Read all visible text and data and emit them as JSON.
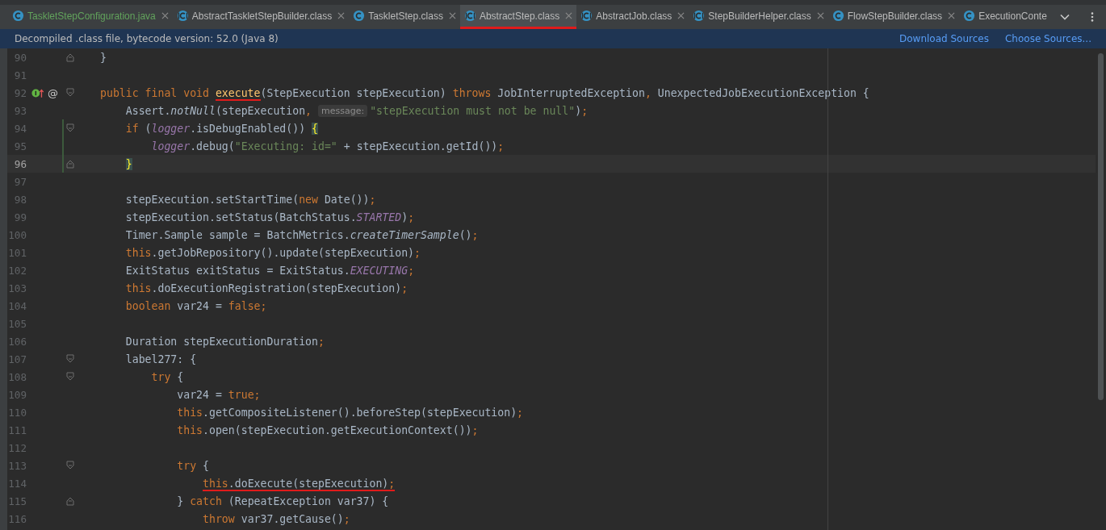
{
  "tabs": [
    {
      "label": "TaskletStepConfiguration.java",
      "kind": "class",
      "color": "#62a35c",
      "selected": false
    },
    {
      "label": "AbstractTaskletStepBuilder.class",
      "kind": "abstract-class",
      "color": "#bbbbbb",
      "selected": false
    },
    {
      "label": "TaskletStep.class",
      "kind": "class",
      "color": "#bbbbbb",
      "selected": false
    },
    {
      "label": "AbstractStep.class",
      "kind": "abstract-class",
      "color": "#bbbbbb",
      "selected": true
    },
    {
      "label": "AbstractJob.class",
      "kind": "abstract-class",
      "color": "#bbbbbb",
      "selected": false
    },
    {
      "label": "StepBuilderHelper.class",
      "kind": "abstract-class",
      "color": "#bbbbbb",
      "selected": false
    },
    {
      "label": "FlowStepBuilder.class",
      "kind": "class",
      "color": "#bbbbbb",
      "selected": false
    },
    {
      "label": "ExecutionConte",
      "kind": "class",
      "color": "#bbbbbb",
      "selected": false
    }
  ],
  "banner": {
    "message": "Decompiled .class file, bytecode version: 52.0 (Java 8)",
    "links": [
      "Download Sources",
      "Choose Sources..."
    ]
  },
  "lines": [
    {
      "number": "90",
      "fold_end": true,
      "tokens": [
        {
          "kind": "plain",
          "text": "}"
        }
      ]
    },
    {
      "number": "91"
    },
    {
      "number": "92",
      "fold_start": true,
      "gutter": "@",
      "implements": true,
      "tokens": [
        {
          "kind": "keyword",
          "text": "public final void "
        },
        {
          "kind": "declaration",
          "text": "execute",
          "underlined": true
        },
        {
          "kind": "plain",
          "text": "(StepExecution stepExecution) "
        },
        {
          "kind": "keyword",
          "text": "throws "
        },
        {
          "kind": "plain",
          "text": "JobInterruptedException"
        },
        {
          "kind": "keyword",
          "text": ", "
        },
        {
          "kind": "plain",
          "text": "UnexpectedJobExecutionException {"
        }
      ]
    },
    {
      "number": "93",
      "tokens": [
        {
          "kind": "plain",
          "text": "    Assert."
        },
        {
          "kind": "static",
          "text": "notNull"
        },
        {
          "kind": "plain",
          "text": "(stepExecution"
        },
        {
          "kind": "keyword",
          "text": ", "
        },
        {
          "kind": "hint",
          "text": "message:"
        },
        {
          "kind": "string",
          "text": "\"stepExecution must not be null\""
        },
        {
          "kind": "plain",
          "text": ")"
        },
        {
          "kind": "keyword",
          "text": ";"
        }
      ]
    },
    {
      "number": "94",
      "fold_start": true,
      "changed": true,
      "tokens": [
        {
          "kind": "keyword",
          "text": "    if "
        },
        {
          "kind": "plain",
          "text": "("
        },
        {
          "kind": "field",
          "text": "logger"
        },
        {
          "kind": "plain",
          "text": ".isDebugEnabled()) "
        },
        {
          "kind": "brace",
          "text": "{"
        }
      ]
    },
    {
      "number": "95",
      "changed": true,
      "tokens": [
        {
          "kind": "field",
          "text": "        logger"
        },
        {
          "kind": "plain",
          "text": ".debug("
        },
        {
          "kind": "string",
          "text": "\"Executing: id=\""
        },
        {
          "kind": "plain",
          "text": " + stepExecution.getId())"
        },
        {
          "kind": "keyword",
          "text": ";"
        }
      ]
    },
    {
      "number": "96",
      "fold_end": true,
      "changed": true,
      "current": true,
      "tokens": [
        {
          "kind": "brace",
          "text": "    }"
        }
      ]
    },
    {
      "number": "97"
    },
    {
      "number": "98",
      "tokens": [
        {
          "kind": "plain",
          "text": "    stepExecution.setStartTime("
        },
        {
          "kind": "keyword",
          "text": "new "
        },
        {
          "kind": "plain",
          "text": "Date())"
        },
        {
          "kind": "keyword",
          "text": ";"
        }
      ]
    },
    {
      "number": "99",
      "tokens": [
        {
          "kind": "plain",
          "text": "    stepExecution.setStatus(BatchStatus."
        },
        {
          "kind": "constant",
          "text": "STARTED"
        },
        {
          "kind": "plain",
          "text": ")"
        },
        {
          "kind": "keyword",
          "text": ";"
        }
      ]
    },
    {
      "number": "100",
      "tokens": [
        {
          "kind": "plain",
          "text": "    Timer.Sample sample = BatchMetrics."
        },
        {
          "kind": "static",
          "text": "createTimerSample"
        },
        {
          "kind": "plain",
          "text": "()"
        },
        {
          "kind": "keyword",
          "text": ";"
        }
      ]
    },
    {
      "number": "101",
      "tokens": [
        {
          "kind": "keyword",
          "text": "    this"
        },
        {
          "kind": "plain",
          "text": ".getJobRepository().update(stepExecution)"
        },
        {
          "kind": "keyword",
          "text": ";"
        }
      ]
    },
    {
      "number": "102",
      "tokens": [
        {
          "kind": "plain",
          "text": "    ExitStatus exitStatus = ExitStatus."
        },
        {
          "kind": "constant",
          "text": "EXECUTING"
        },
        {
          "kind": "keyword",
          "text": ";"
        }
      ]
    },
    {
      "number": "103",
      "tokens": [
        {
          "kind": "keyword",
          "text": "    this"
        },
        {
          "kind": "plain",
          "text": ".doExecutionRegistration(stepExecution)"
        },
        {
          "kind": "keyword",
          "text": ";"
        }
      ]
    },
    {
      "number": "104",
      "tokens": [
        {
          "kind": "keyword",
          "text": "    boolean "
        },
        {
          "kind": "plain",
          "text": "var24 = "
        },
        {
          "kind": "keyword",
          "text": "false;"
        }
      ]
    },
    {
      "number": "105"
    },
    {
      "number": "106",
      "tokens": [
        {
          "kind": "plain",
          "text": "    Duration stepExecutionDuration"
        },
        {
          "kind": "keyword",
          "text": ";"
        }
      ]
    },
    {
      "number": "107",
      "fold_start": true,
      "tokens": [
        {
          "kind": "plain",
          "text": "    label277: {"
        }
      ]
    },
    {
      "number": "108",
      "fold_start": true,
      "tokens": [
        {
          "kind": "keyword",
          "text": "        try "
        },
        {
          "kind": "plain",
          "text": "{"
        }
      ]
    },
    {
      "number": "109",
      "tokens": [
        {
          "kind": "plain",
          "text": "            var24 = "
        },
        {
          "kind": "keyword",
          "text": "true;"
        }
      ]
    },
    {
      "number": "110",
      "tokens": [
        {
          "kind": "keyword",
          "text": "            this"
        },
        {
          "kind": "plain",
          "text": ".getCompositeListener().beforeStep(stepExecution)"
        },
        {
          "kind": "keyword",
          "text": ";"
        }
      ]
    },
    {
      "number": "111",
      "tokens": [
        {
          "kind": "keyword",
          "text": "            this"
        },
        {
          "kind": "plain",
          "text": ".open(stepExecution.getExecutionContext())"
        },
        {
          "kind": "keyword",
          "text": ";"
        }
      ]
    },
    {
      "number": "112"
    },
    {
      "number": "113",
      "fold_start": true,
      "tokens": [
        {
          "kind": "keyword",
          "text": "            try "
        },
        {
          "kind": "plain",
          "text": "{"
        }
      ]
    },
    {
      "number": "114",
      "tokens": [
        {
          "kind": "keyword",
          "text": "                this",
          "underlined": true
        },
        {
          "kind": "plain",
          "text": ".doExecute(stepExecution)",
          "underlined": true
        },
        {
          "kind": "keyword",
          "text": ";",
          "underlined": true
        }
      ]
    },
    {
      "number": "115",
      "fold_end": true,
      "tokens": [
        {
          "kind": "plain",
          "text": "            } "
        },
        {
          "kind": "keyword",
          "text": "catch "
        },
        {
          "kind": "plain",
          "text": "(RepeatException var37) {"
        }
      ]
    },
    {
      "number": "116",
      "tokens": [
        {
          "kind": "keyword",
          "text": "                throw "
        },
        {
          "kind": "plain",
          "text": "var37.getCause()"
        },
        {
          "kind": "keyword",
          "text": ";"
        }
      ]
    }
  ]
}
